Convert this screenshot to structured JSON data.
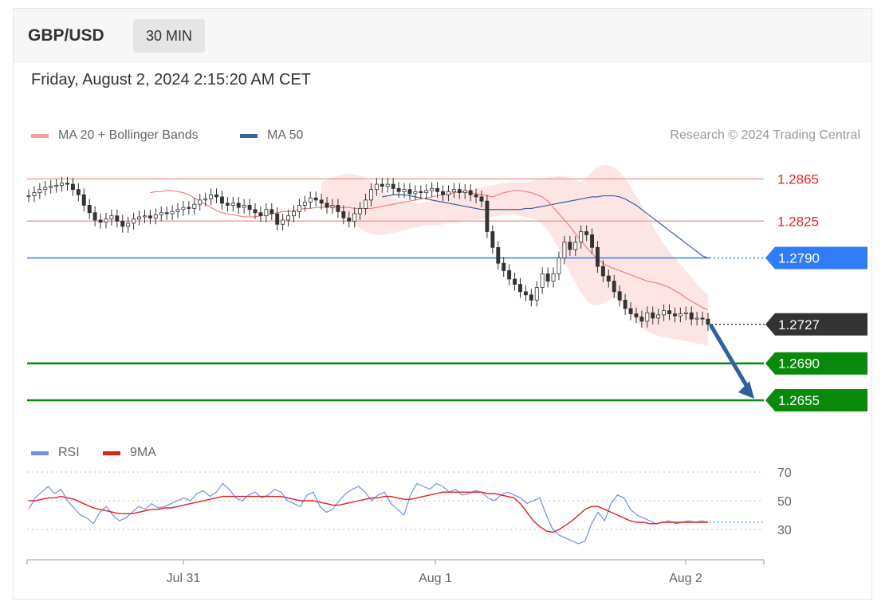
{
  "header": {
    "symbol": "GBP/USD",
    "timeframe": "30 MIN",
    "datetime": "Friday, August 2, 2024 2:15:20 AM CET"
  },
  "legend": {
    "ma20_label": "MA 20 + Bollinger Bands",
    "ma50_label": "MA 50",
    "credit": "Research © 2024 Trading Central",
    "rsi_label": "RSI",
    "rsi_ma_label": "9MA"
  },
  "colors": {
    "ma20": "#f08080",
    "ma50": "#3b5f9a",
    "bollinger_fill": "#fde2e2",
    "resistance": "#f4a0a0",
    "pivot": "#2f7cf6",
    "support": "#0a8a0a",
    "current": "#333333",
    "candle": "#333333",
    "rsi": "#6f90e6",
    "rsi_ma": "#e02020",
    "arrow": "#2f5f9e"
  },
  "chart_data": [
    {
      "type": "candlestick",
      "title": "GBP/USD",
      "ylim": [
        1.263,
        1.2885
      ],
      "x_ticks": [
        "Jul 31",
        "Aug 1",
        "Aug 2"
      ],
      "levels": [
        {
          "label": "1.2865",
          "value": 1.2865,
          "kind": "resistance"
        },
        {
          "label": "1.2825",
          "value": 1.2825,
          "kind": "resistance"
        },
        {
          "label": "1.2790",
          "value": 1.279,
          "kind": "pivot"
        },
        {
          "label": "1.2727",
          "value": 1.2727,
          "kind": "current"
        },
        {
          "label": "1.2690",
          "value": 1.269,
          "kind": "support"
        },
        {
          "label": "1.2655",
          "value": 1.2655,
          "kind": "support"
        }
      ],
      "close": [
        1.2849,
        1.2852,
        1.2855,
        1.2857,
        1.2858,
        1.2859,
        1.2861,
        1.286,
        1.2855,
        1.285,
        1.284,
        1.2833,
        1.2826,
        1.2824,
        1.2827,
        1.283,
        1.2825,
        1.282,
        1.2823,
        1.2827,
        1.2829,
        1.283,
        1.2828,
        1.2831,
        1.2833,
        1.2832,
        1.2834,
        1.2836,
        1.2838,
        1.2837,
        1.2841,
        1.2845,
        1.2846,
        1.285,
        1.2848,
        1.2842,
        1.284,
        1.2842,
        1.2838,
        1.284,
        1.2836,
        1.2833,
        1.283,
        1.2836,
        1.2832,
        1.2822,
        1.2826,
        1.283,
        1.2834,
        1.284,
        1.2843,
        1.2847,
        1.2845,
        1.2842,
        1.2838,
        1.284,
        1.2834,
        1.2828,
        1.2825,
        1.2832,
        1.2837,
        1.2845,
        1.2855,
        1.286,
        1.2858,
        1.286,
        1.2856,
        1.2853,
        1.2855,
        1.2851,
        1.2853,
        1.2852,
        1.2854,
        1.2856,
        1.2853,
        1.285,
        1.2853,
        1.2855,
        1.2852,
        1.2854,
        1.285,
        1.2848,
        1.2844,
        1.2815,
        1.28,
        1.2785,
        1.2778,
        1.277,
        1.2765,
        1.2758,
        1.2755,
        1.275,
        1.2762,
        1.2775,
        1.2768,
        1.2775,
        1.279,
        1.2805,
        1.2798,
        1.2805,
        1.2815,
        1.2812,
        1.28,
        1.2782,
        1.2773,
        1.2768,
        1.2758,
        1.275,
        1.2742,
        1.2737,
        1.2734,
        1.273,
        1.2738,
        1.2733,
        1.2736,
        1.274,
        1.2737,
        1.2735,
        1.2737,
        1.2738,
        1.2732,
        1.2733,
        1.2732,
        1.2727
      ],
      "ma20": [
        1.2852,
        1.2853,
        1.2853,
        1.2854,
        1.2854,
        1.2853,
        1.2852,
        1.285,
        1.2847,
        1.2844,
        1.2841,
        1.2838,
        1.2835,
        1.2833,
        1.2832,
        1.2831,
        1.283,
        1.2829,
        1.2829,
        1.2829,
        1.283,
        1.2831,
        1.2832,
        1.2833,
        1.2834,
        1.2834,
        1.2835,
        1.2836,
        1.2837,
        1.2837,
        1.2838,
        1.2838,
        1.2839,
        1.2839,
        1.2838,
        1.2838,
        1.2838,
        1.2837,
        1.2837,
        1.2837,
        1.2837,
        1.2838,
        1.2839,
        1.284,
        1.2841,
        1.2842,
        1.2843,
        1.2844,
        1.2845,
        1.2846,
        1.2847,
        1.2848,
        1.2849,
        1.285,
        1.2851,
        1.2852,
        1.2853,
        1.2853,
        1.2852,
        1.2851,
        1.285,
        1.2849,
        1.2848,
        1.285,
        1.2852,
        1.2853,
        1.2854,
        1.2854,
        1.2853,
        1.2852,
        1.285,
        1.2848,
        1.2844,
        1.2838,
        1.2832,
        1.2826,
        1.282,
        1.2813,
        1.2807,
        1.28,
        1.2794,
        1.2789,
        1.2785,
        1.2782,
        1.278,
        1.2778,
        1.2776,
        1.2774,
        1.2772,
        1.277,
        1.2768,
        1.2767,
        1.2766,
        1.2764,
        1.2762,
        1.2759,
        1.2756,
        1.2752,
        1.2749,
        1.2746,
        1.2743,
        1.2741
      ],
      "ma50": [
        1.2848,
        1.2849,
        1.285,
        1.285,
        1.285,
        1.2849,
        1.2848,
        1.2847,
        1.2846,
        1.2845,
        1.2844,
        1.2843,
        1.2842,
        1.2841,
        1.284,
        1.2839,
        1.2838,
        1.2837,
        1.2836,
        1.2836,
        1.2836,
        1.2836,
        1.2836,
        1.2836,
        1.2836,
        1.2836,
        1.2837,
        1.2837,
        1.2838,
        1.2839,
        1.284,
        1.2841,
        1.2842,
        1.2843,
        1.2844,
        1.2845,
        1.2846,
        1.2847,
        1.2848,
        1.2848,
        1.2849,
        1.2849,
        1.2849,
        1.2848,
        1.2846,
        1.2843,
        1.284,
        1.2836,
        1.2832,
        1.2828,
        1.2824,
        1.282,
        1.2816,
        1.2812,
        1.2808,
        1.2804,
        1.28,
        1.2796,
        1.2792,
        1.279
      ],
      "bb_upper": [
        1.2862,
        1.2864,
        1.2866,
        1.2868,
        1.2869,
        1.287,
        1.2869,
        1.2868,
        1.2866,
        1.2862,
        1.2858,
        1.2854,
        1.285,
        1.2847,
        1.2845,
        1.2844,
        1.2843,
        1.2842,
        1.2842,
        1.2843,
        1.2845,
        1.2847,
        1.2849,
        1.2851,
        1.2852,
        1.2852,
        1.2853,
        1.2854,
        1.2855,
        1.2857,
        1.2858,
        1.2859,
        1.286,
        1.2861,
        1.2862,
        1.2862,
        1.2862,
        1.2862,
        1.2863,
        1.2864,
        1.2865,
        1.2866,
        1.2867,
        1.2868,
        1.2868,
        1.2866,
        1.2864,
        1.2862,
        1.2866,
        1.2872,
        1.2876,
        1.2878,
        1.2878,
        1.2876,
        1.2872,
        1.2866,
        1.2858,
        1.2849,
        1.284,
        1.283,
        1.282,
        1.2811,
        1.2803,
        1.2796,
        1.279,
        1.2784,
        1.2778,
        1.2772,
        1.2765,
        1.276,
        1.2755
      ],
      "bb_lower": [
        1.284,
        1.2838,
        1.2836,
        1.2834,
        1.283,
        1.2826,
        1.2822,
        1.2818,
        1.2815,
        1.2813,
        1.2812,
        1.2812,
        1.2813,
        1.2814,
        1.2815,
        1.2816,
        1.2818,
        1.2819,
        1.282,
        1.2821,
        1.2821,
        1.2821,
        1.2822,
        1.2823,
        1.2823,
        1.2824,
        1.2825,
        1.2826,
        1.2826,
        1.2827,
        1.2828,
        1.2829,
        1.283,
        1.2831,
        1.2831,
        1.2831,
        1.283,
        1.2829,
        1.2828,
        1.2826,
        1.2822,
        1.2816,
        1.2808,
        1.2798,
        1.2787,
        1.2776,
        1.2766,
        1.2757,
        1.275,
        1.2746,
        1.2745,
        1.2747,
        1.275,
        1.2752,
        1.275,
        1.2745,
        1.2738,
        1.273,
        1.2724,
        1.272,
        1.2718,
        1.2716,
        1.2715,
        1.2714,
        1.2713,
        1.2712,
        1.2711,
        1.271,
        1.2709,
        1.2708,
        1.2707
      ]
    },
    {
      "type": "line",
      "title": "RSI",
      "ylim": [
        10,
        80
      ],
      "y_ticks": [
        70,
        50,
        30
      ],
      "series": [
        {
          "name": "RSI",
          "values": [
            44,
            52,
            56,
            60,
            55,
            58,
            50,
            45,
            40,
            38,
            34,
            42,
            46,
            40,
            36,
            38,
            42,
            46,
            44,
            48,
            45,
            46,
            48,
            50,
            52,
            50,
            55,
            57,
            53,
            56,
            62,
            58,
            52,
            50,
            54,
            56,
            52,
            54,
            58,
            56,
            50,
            48,
            46,
            54,
            56,
            46,
            42,
            44,
            50,
            55,
            58,
            60,
            56,
            50,
            54,
            56,
            48,
            44,
            40,
            54,
            62,
            60,
            58,
            62,
            60,
            56,
            58,
            54,
            55,
            57,
            56,
            52,
            50,
            54,
            56,
            54,
            52,
            48,
            50,
            52,
            40,
            30,
            26,
            24,
            22,
            20,
            22,
            34,
            42,
            36,
            48,
            54,
            52,
            44,
            40,
            38,
            36,
            34,
            35,
            36,
            34,
            35,
            36,
            35,
            36,
            35
          ]
        },
        {
          "name": "9MA",
          "values": [
            50,
            50,
            51,
            52,
            52,
            53,
            52,
            51,
            49,
            47,
            45,
            44,
            43,
            42,
            41,
            41,
            41,
            42,
            43,
            44,
            44,
            45,
            45,
            46,
            47,
            48,
            49,
            50,
            51,
            52,
            53,
            53,
            53,
            53,
            53,
            53,
            53,
            53,
            53,
            53,
            52,
            51,
            50,
            50,
            50,
            49,
            48,
            47,
            47,
            48,
            49,
            50,
            51,
            52,
            52,
            53,
            53,
            52,
            51,
            51,
            52,
            53,
            54,
            55,
            56,
            56,
            56,
            56,
            56,
            56,
            56,
            55,
            55,
            54,
            53,
            52,
            48,
            42,
            36,
            32,
            29,
            28,
            30,
            33,
            36,
            40,
            44,
            46,
            46,
            44,
            42,
            40,
            38,
            36,
            35,
            35,
            34,
            34,
            35,
            35,
            35,
            35,
            35,
            35,
            35,
            35
          ]
        }
      ]
    }
  ]
}
